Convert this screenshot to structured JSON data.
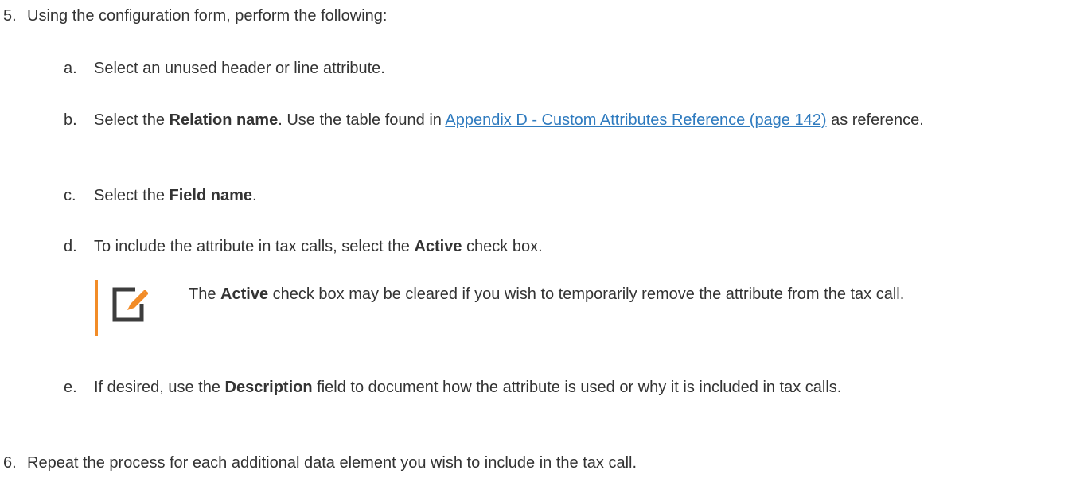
{
  "step5": {
    "number": "5.",
    "text": "Using the configuration form, perform the following:"
  },
  "sub_a": {
    "letter": "a.",
    "text": "Select an unused header or line attribute."
  },
  "sub_b": {
    "letter": "b.",
    "pre": "Select the ",
    "bold": "Relation name",
    "mid": ". Use the table found in ",
    "link": "Appendix D - Custom Attributes Reference (page 142)",
    "post": " as reference."
  },
  "sub_c": {
    "letter": "c.",
    "pre": "Select the ",
    "bold": "Field name",
    "post": "."
  },
  "sub_d": {
    "letter": "d.",
    "pre": "To include the attribute in tax calls, select the ",
    "bold": "Active",
    "post": " check box."
  },
  "note": {
    "icon": "note-edit-icon",
    "pre": "The ",
    "bold": "Active",
    "post": " check box may be cleared if you wish to temporarily remove the attribute from the tax call."
  },
  "sub_e": {
    "letter": "e.",
    "pre": "If desired, use the ",
    "bold": "Description",
    "post": " field to document how the attribute is used or why it is included in tax calls."
  },
  "step6": {
    "number": "6.",
    "text": "Repeat the process for each additional data element you wish to include in the tax call."
  },
  "colors": {
    "text": "#333333",
    "link": "#2f7bbf",
    "note_bar": "#f28c28",
    "icon_gray": "#3d3d3d",
    "icon_pencil": "#f28c28"
  }
}
